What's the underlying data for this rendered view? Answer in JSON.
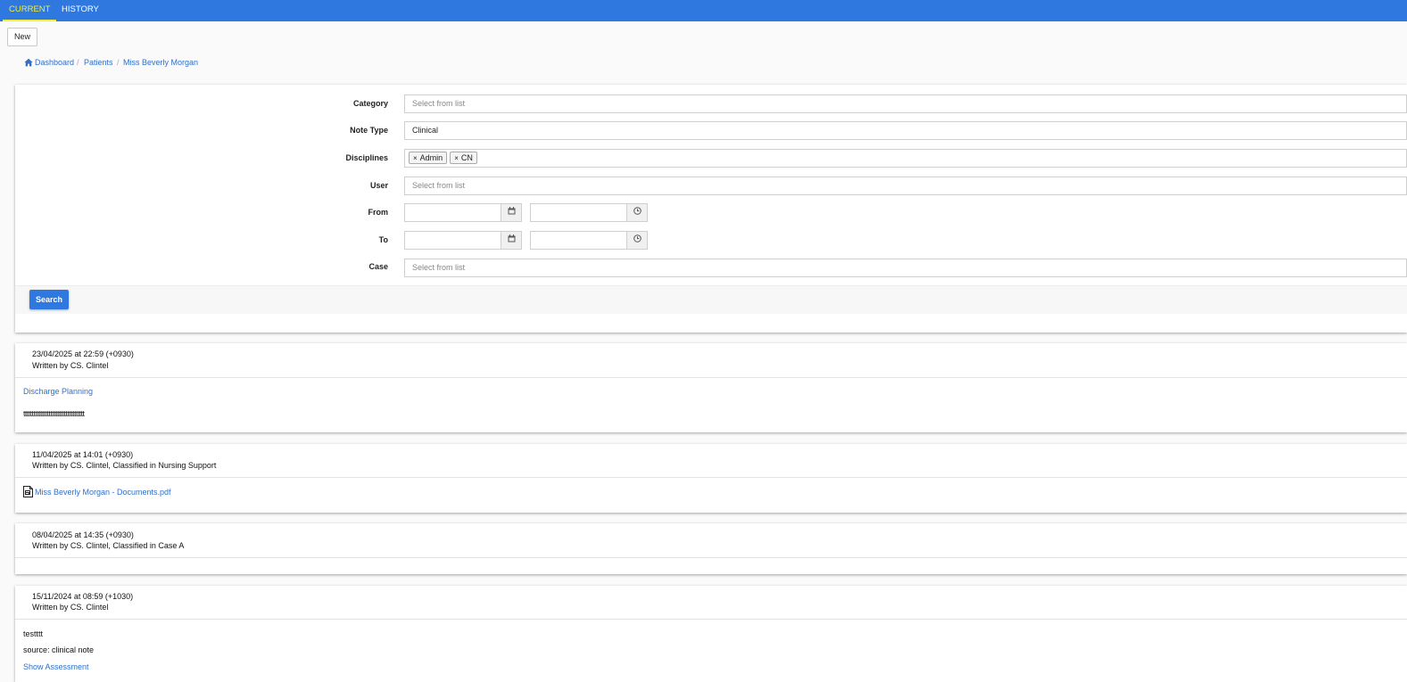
{
  "tabs": [
    {
      "label": "CURRENT",
      "active": true
    },
    {
      "label": "HISTORY",
      "active": false
    }
  ],
  "toolbar": {
    "new_label": "New"
  },
  "breadcrumb": {
    "home_icon": "home-icon",
    "items": [
      "Dashboard",
      "Patients",
      "Miss Beverly Morgan"
    ],
    "separator": "/"
  },
  "filter": {
    "category": {
      "label": "Category",
      "placeholder": "Select from list"
    },
    "note_type": {
      "label": "Note Type",
      "value": "Clinical"
    },
    "disciplines": {
      "label": "Disciplines",
      "chips": [
        "Admin",
        "CN"
      ]
    },
    "user": {
      "label": "User",
      "placeholder": "Select from list"
    },
    "from": {
      "label": "From",
      "date": "",
      "time": ""
    },
    "to": {
      "label": "To",
      "date": "",
      "time": ""
    },
    "case": {
      "label": "Case",
      "placeholder": "Select from list"
    },
    "search_label": "Search"
  },
  "notes": [
    {
      "date": "23/04/2025 at 22:59 (+0930)",
      "byline": "Written by CS. Clintel",
      "title": "Discharge Planning",
      "body": "tttttttttttttttttttttttttttttttttttt"
    },
    {
      "date": "11/04/2025 at 14:01 (+0930)",
      "byline": "Written by CS. Clintel, Classified in Nursing Support",
      "attachment": "Miss Beverly Morgan - Documents.pdf",
      "attachment_icon": "pdf-file-icon"
    },
    {
      "date": "08/04/2025 at 14:35 (+0930)",
      "byline": "Written by CS. Clintel, Classified in Case A"
    },
    {
      "date": "15/11/2024 at 08:59 (+1030)",
      "byline": "Written by CS. Clintel",
      "body": "testttt",
      "source": "source: clinical note",
      "link": "Show Assessment"
    }
  ],
  "colors": {
    "primary": "#2f78e0",
    "active_tab": "#f3ef3a",
    "link": "#2f70c9"
  }
}
